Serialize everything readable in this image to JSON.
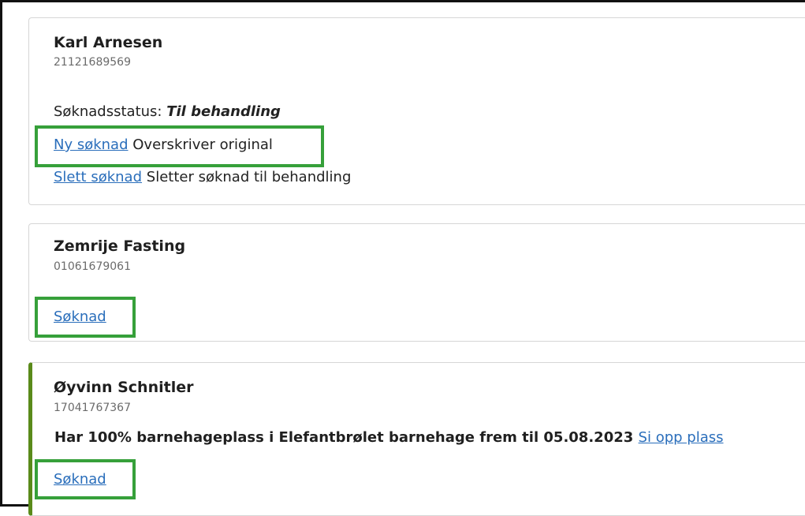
{
  "persons": [
    {
      "name": "Karl Arnesen",
      "id": "21121689569",
      "status_label": "Søknadsstatus:",
      "status_value": "Til behandling",
      "actions": [
        {
          "link": "Ny søknad",
          "description": "Overskriver original"
        },
        {
          "link": "Slett søknad",
          "description": "Sletter søknad til behandling"
        }
      ]
    },
    {
      "name": "Zemrije Fasting",
      "id": "01061679061",
      "application_link": "Søknad"
    },
    {
      "name": "Øyvinn Schnitler",
      "id": "17041767367",
      "info": "Har 100% barnehageplass i Elefantbrølet barnehage frem til 05.08.2023",
      "info_link": "Si opp plass",
      "application_link": "Søknad"
    }
  ],
  "highlight_color": "#36a03a",
  "accent_color": "#5a8a1a",
  "link_color": "#2a6ebb"
}
